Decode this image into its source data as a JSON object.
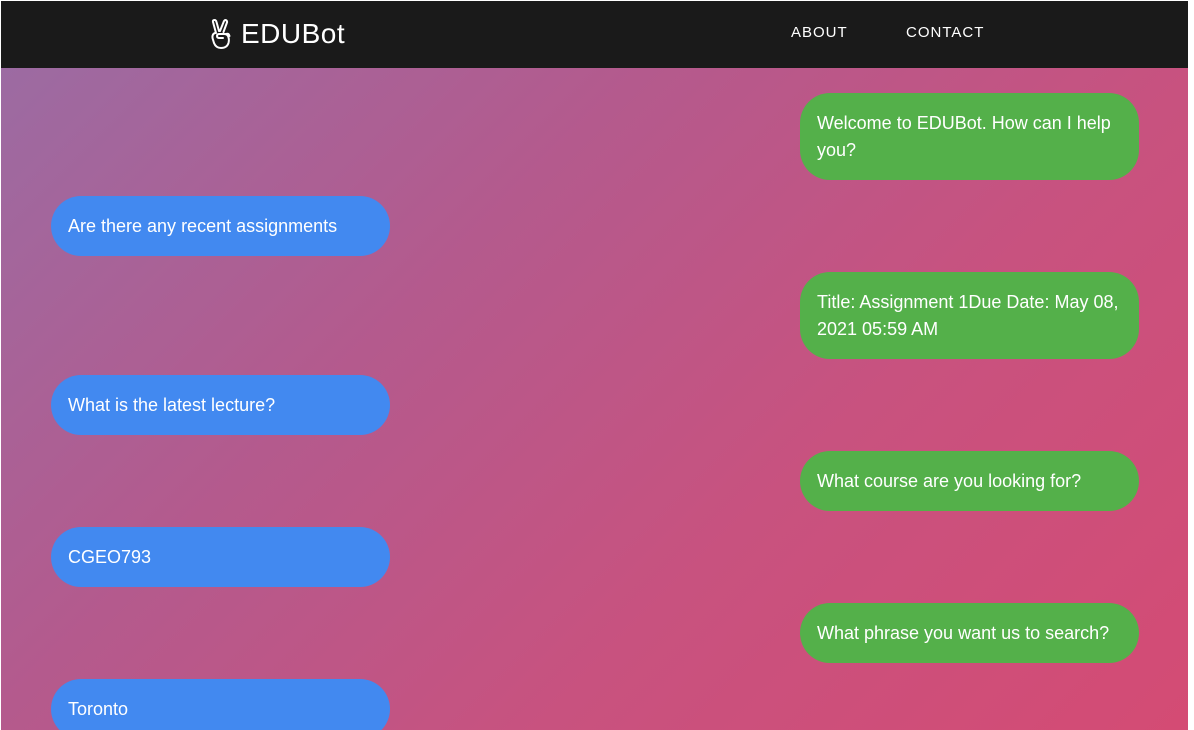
{
  "navbar": {
    "brand_icon": "peace-hand-icon",
    "brand_name": "EDUBot",
    "links": [
      "ABOUT",
      "CONTACT"
    ]
  },
  "colors": {
    "navbar_bg": "#1a1a1a",
    "bot_bubble": "#54b04a",
    "user_bubble": "#4289f0",
    "gradient_start": "#9c6ba2",
    "gradient_end": "#d44b74"
  },
  "messages": [
    {
      "sender": "bot",
      "text": "Welcome to EDUBot. How can I help you?"
    },
    {
      "sender": "user",
      "text": "Are there any recent assignments"
    },
    {
      "sender": "bot",
      "text": "Title: Assignment 1Due Date: May 08, 2021 05:59 AM"
    },
    {
      "sender": "user",
      "text": "What is the latest lecture?"
    },
    {
      "sender": "bot",
      "text": "What course are you looking for?"
    },
    {
      "sender": "user",
      "text": "CGEO793"
    },
    {
      "sender": "bot",
      "text": "What phrase you want us to search?"
    },
    {
      "sender": "user",
      "text": "Toronto"
    }
  ]
}
